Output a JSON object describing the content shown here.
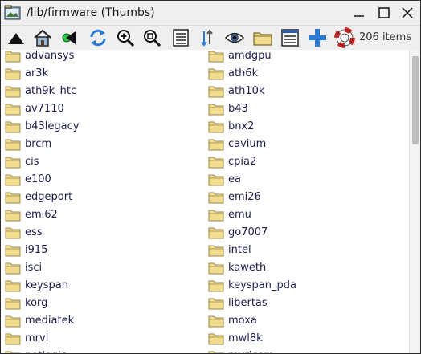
{
  "window": {
    "title": "/lib/firmware (Thumbs)",
    "controls": [
      "minimize",
      "maximize",
      "close"
    ]
  },
  "toolbar": {
    "buttons": [
      {
        "name": "parent-directory",
        "icon": "up-triangle-icon"
      },
      {
        "name": "home",
        "icon": "home-icon"
      },
      {
        "name": "back",
        "icon": "back-arrow-icon"
      },
      {
        "name": "refresh",
        "icon": "refresh-icon"
      },
      {
        "name": "zoom-in",
        "icon": "zoom-in-icon"
      },
      {
        "name": "zoom-fit",
        "icon": "zoom-fit-icon"
      },
      {
        "name": "list-view",
        "icon": "list-view-icon"
      },
      {
        "name": "sort",
        "icon": "sort-icon"
      },
      {
        "name": "toggle-hidden",
        "icon": "eye-icon"
      },
      {
        "name": "new-folder",
        "icon": "folder-icon"
      },
      {
        "name": "details-view",
        "icon": "details-view-icon"
      },
      {
        "name": "add",
        "icon": "plus-icon"
      },
      {
        "name": "help",
        "icon": "lifebuoy-icon"
      }
    ],
    "item_count": "206 items"
  },
  "files": {
    "left": [
      "advansys",
      "ar3k",
      "ath9k_htc",
      "av7110",
      "b43legacy",
      "brcm",
      "cis",
      "e100",
      "edgeport",
      "emi62",
      "ess",
      "i915",
      "isci",
      "keyspan",
      "korg",
      "mediatek",
      "mrvl",
      "netlogic"
    ],
    "right": [
      "amdgpu",
      "ath6k",
      "ath10k",
      "b43",
      "bnx2",
      "cavium",
      "cpia2",
      "ea",
      "emi26",
      "emu",
      "go7007",
      "intel",
      "kaweth",
      "keyspan_pda",
      "libertas",
      "moxa",
      "mwl8k",
      "myricom"
    ]
  },
  "colors": {
    "folder": "#f0dc8c",
    "folder_edge": "#9a8850",
    "filename_text": "#202050",
    "accent_blue": "#2a7bd6"
  }
}
